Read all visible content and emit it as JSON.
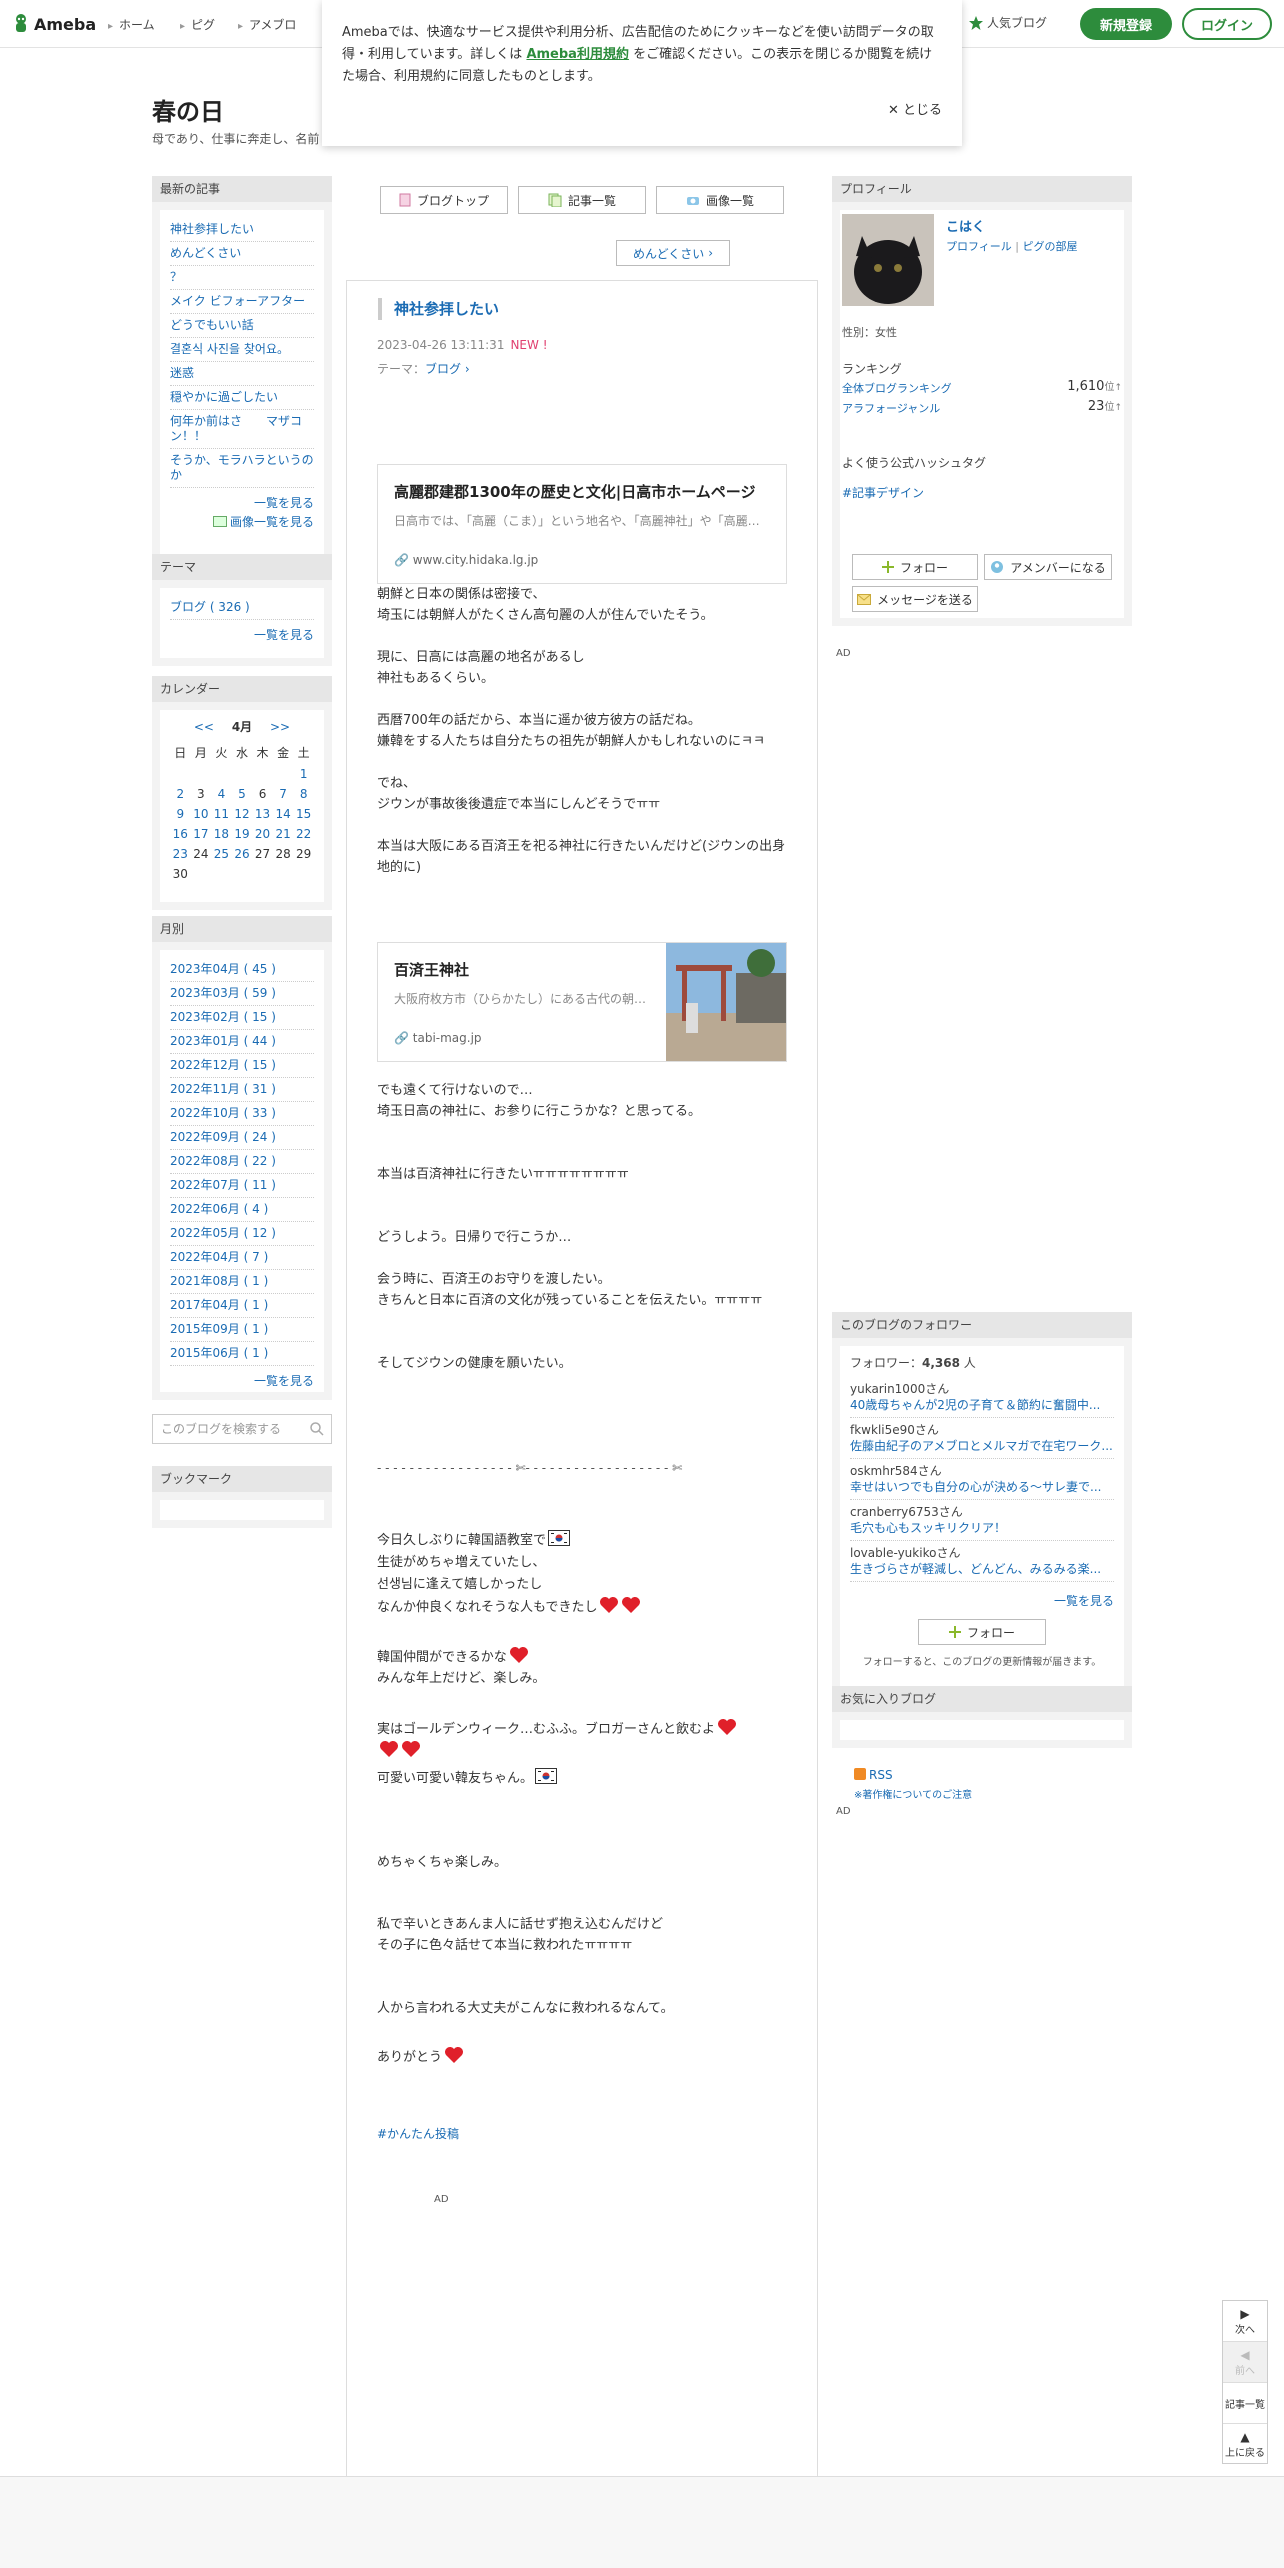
{
  "header": {
    "logo_text": "Ameba",
    "nav": [
      "ホーム",
      "ピグ",
      "アメブロ"
    ],
    "popular": "人気ブログ",
    "signup": "新規登録",
    "login": "ログイン"
  },
  "cookie": {
    "text_before": "Amebaでは、快適なサービス提供や利用分析、広告配信のためにクッキーなどを使い訪問データの取得・利用しています。詳しくは ",
    "link": "Ameba利用規約",
    "text_after": " をご確認ください。この表示を閉じるか閲覧を続けた場合、利用規約に同意したものとします。",
    "close": "とじる"
  },
  "blog": {
    "title": "春の日",
    "desc": "母であり、仕事に奔走し、名前"
  },
  "left": {
    "recent_head": "最新の記事",
    "recent": [
      "神社参拝したい",
      "めんどくさい",
      "？",
      "メイク ビフォーアフター",
      "どうでもいい話",
      "결혼식 사진을 찾어요。",
      "迷惑",
      "穏やかに過ごしたい",
      "何年か前はさ　　マザコン！！",
      "そうか、モラハラというのか"
    ],
    "recent_more": "一覧を見る",
    "recent_img_more": "画像一覧を見る",
    "theme_head": "テーマ",
    "theme_item": "ブログ ( 326 )",
    "theme_more": "一覧を見る",
    "cal_head": "カレンダー",
    "cal_prev": "<<",
    "cal_month": "4月",
    "cal_next": ">>",
    "cal_days": [
      "日",
      "月",
      "火",
      "水",
      "木",
      "金",
      "土"
    ],
    "cal_rows": [
      [
        "",
        "",
        "",
        "",
        "",
        "",
        "1"
      ],
      [
        "2",
        "3",
        "4",
        "5",
        "6",
        "7",
        "8"
      ],
      [
        "9",
        "10",
        "11",
        "12",
        "13",
        "14",
        "15"
      ],
      [
        "16",
        "17",
        "18",
        "19",
        "20",
        "21",
        "22"
      ],
      [
        "23",
        "24",
        "25",
        "26",
        "27",
        "28",
        "29"
      ],
      [
        "30",
        "",
        "",
        "",
        "",
        "",
        ""
      ]
    ],
    "month_head": "月別",
    "months": [
      "2023年04月 ( 45 )",
      "2023年03月 ( 59 )",
      "2023年02月 ( 15 )",
      "2023年01月 ( 44 )",
      "2022年12月 ( 15 )",
      "2022年11月 ( 31 )",
      "2022年10月 ( 33 )",
      "2022年09月 ( 24 )",
      "2022年08月 ( 22 )",
      "2022年07月 ( 11 )",
      "2022年06月 ( 4 )",
      "2022年05月 ( 12 )",
      "2022年04月 ( 7 )",
      "2021年08月 ( 1 )",
      "2017年04月 ( 1 )",
      "2015年09月 ( 1 )",
      "2015年06月 ( 1 )"
    ],
    "month_more": "一覧を見る",
    "search_placeholder": "このブログを検索する",
    "bookmark_head": "ブックマーク"
  },
  "main": {
    "tab_top": "ブログトップ",
    "tab_list": "記事一覧",
    "tab_images": "画像一覧",
    "prev_link": "めんどくさい",
    "title": "神社参拝したい",
    "date": "2023-04-26 13:11:31",
    "new": "NEW !",
    "theme_label": "テーマ：",
    "theme": "ブログ",
    "card1_title": "高麗郡建郡1300年の歴史と文化|日高市ホームページ",
    "card1_desc": "日高市では、「高麗（こま）」という地名や、「高麗神社」や「高麗川」等の...",
    "card1_url": "www.city.hidaka.lg.jp",
    "para1": "朝鮮と日本の関係は密接で、\n埼玉には朝鮮人がたくさん高句麗の人が住んでいたそう。\n\n現に、日高には高麗の地名があるし\n神社もあるくらい。\n\n西暦700年の話だから、本当に遥か彼方彼方の話だね。\n嫌韓をする人たちは自分たちの祖先が朝鮮人かもしれないのにㅋㅋ\n\nでね、\nジウンが事故後後遺症で本当にしんどそうでㅠㅠ\n\n本当は大阪にある百済王を祀る神社に行きたいんだけど(ジウンの出身地的に)",
    "card2_title": "百済王神社",
    "card2_desc": "大阪府枚方市（ひらかたし）にある古代の朝鮮...",
    "card2_url": "tabi-mag.jp",
    "para2": "でも遠くて行けないので…\n埼玉日高の神社に、お参りに行こうかな？と思ってる。\n\n\n本当は百済神社に行きたいㅠㅠㅠㅠㅠㅠㅠㅠ\n\n\nどうしよう。日帰りで行こうか…\n\n会う時に、百済王のお守りを渡したい。\nきちんと日本に百済の文化が残っていることを伝えたい。ㅠㅠㅠㅠ\n\n\nそしてジウンの健康を願いたい。",
    "separator": "- - - - - - - - - - - - - - - - - ✄- - - - - - - - - - - - - - - - - - ✄",
    "l_today": "今日久しぶりに韓国語教室で",
    "l_students": "生徒がめちゃ増えていたし、",
    "l_teacher": "선생님に逢えて嬉しかったし",
    "l_friend": "なんか仲良くなれそうな人もできたし",
    "l_mates": "韓国仲間ができるかな",
    "l_older": "みんな年上だけど、楽しみ。",
    "l_gw": "実はゴールデンウィーク…むふふ。ブロガーさんと飲むよ",
    "l_cute": "可愛い可愛い韓友ちゃん。",
    "l_fun": "めちゃくちゃ楽しみ。",
    "l_hurt": "私で辛いときあんま人に話せず抱え込むんだけど\nその子に色々話せて本当に救われたㅠㅠㅠㅠ",
    "l_saved": "人から言われる大丈夫がこんなに救われるなんて。",
    "l_thanks": "ありがとう",
    "hashtag": "#かんたん投稿",
    "ad": "AD"
  },
  "right": {
    "profile_head": "プロフィール",
    "name": "こはく",
    "profile_link": "プロフィール",
    "pig_link": "ピグの部屋",
    "gender": "性別：女性",
    "ranking": "ランキング",
    "rank1_label": "全体ブログランキング",
    "rank1_value": "1,610",
    "rank2_label": "アラフォージャンル",
    "rank2_value": "23",
    "rank_unit": "位",
    "hashtag_head": "よく使う公式ハッシュタグ",
    "hashtag": "#記事デザイン",
    "follow": "フォロー",
    "member": "アメンバーになる",
    "message": "メッセージを送る",
    "ad": "AD",
    "followers_head": "このブログのフォロワー",
    "followers_label": "フォロワー：",
    "followers_count": "4,368",
    "followers_unit": " 人",
    "followers": [
      {
        "name": "yukarin1000さん",
        "post": "40歳母ちゃんが2児の子育て＆節約に奮闘中..."
      },
      {
        "name": "fkwkli5e90さん",
        "post": "佐藤由紀子のアメブロとメルマガで在宅ワーク..."
      },
      {
        "name": "oskmhr584さん",
        "post": "幸せはいつでも自分の心が決める〜サレ妻で..."
      },
      {
        "name": "cranberry6753さん",
        "post": "毛穴も心もスッキリクリア！"
      },
      {
        "name": "lovable-yukikoさん",
        "post": "生きづらさが軽減し、どんどん、みるみる楽..."
      }
    ],
    "followers_more": "一覧を見る",
    "follow2": "フォロー",
    "follow_note": "フォローすると、このブログの更新情報が届きます。",
    "fav_head": "お気に入りブログ",
    "rss": "RSS",
    "copyright": "※著作権についてのご注意",
    "ad2": "AD"
  },
  "floatnav": {
    "next": "次へ",
    "prev": "前へ",
    "list": "記事一覧",
    "top": "上に戻る"
  }
}
